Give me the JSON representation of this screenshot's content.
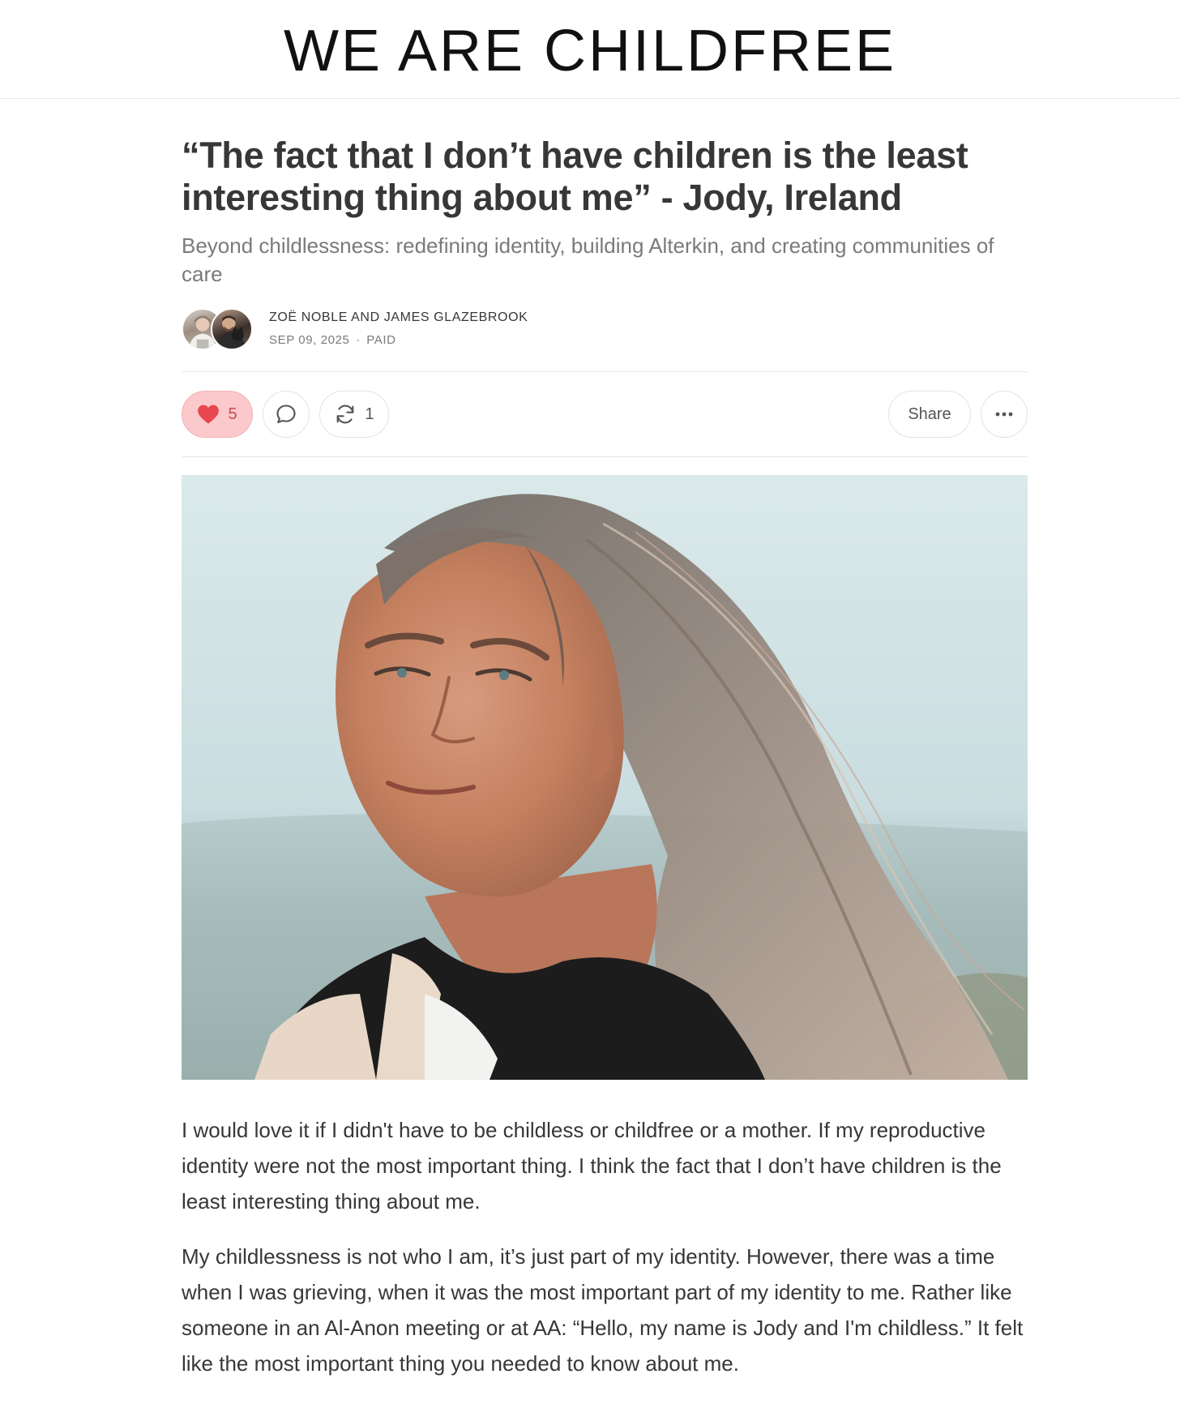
{
  "masthead": {
    "title": "WE ARE CHILDFREE"
  },
  "post": {
    "title": "“The fact that I don’t have children is the least interesting thing about me” - Jody, Ireland",
    "subtitle": "Beyond childlessness: redefining identity, building Alterkin, and creating communities of care",
    "authors": "ZOË NOBLE AND JAMES GLAZEBROOK",
    "date": "SEP 09, 2025",
    "separator": "∙",
    "access": "PAID"
  },
  "actions": {
    "like_count": "5",
    "restack_count": "1",
    "share_label": "Share",
    "like_icon": "heart-icon",
    "comment_icon": "comment-bubble-icon",
    "restack_icon": "restack-arrows-icon",
    "more_icon": "ellipsis-icon",
    "like_color": "#e8474f"
  },
  "body": {
    "paragraphs": [
      "I would love it if I didn't have to be childless or childfree or a mother. If my reproductive identity were not the most important thing. I think the fact that I don’t have children is the least interesting thing about me.",
      "My childlessness is not who I am, it’s just part of my identity. However, there was a time when I was grieving, when it was the most important part of my identity to me. Rather like someone in an Al-Anon meeting or at AA: “Hello, my name is Jody and I'm childless.” It felt like the most important thing you needed to know about me."
    ]
  }
}
